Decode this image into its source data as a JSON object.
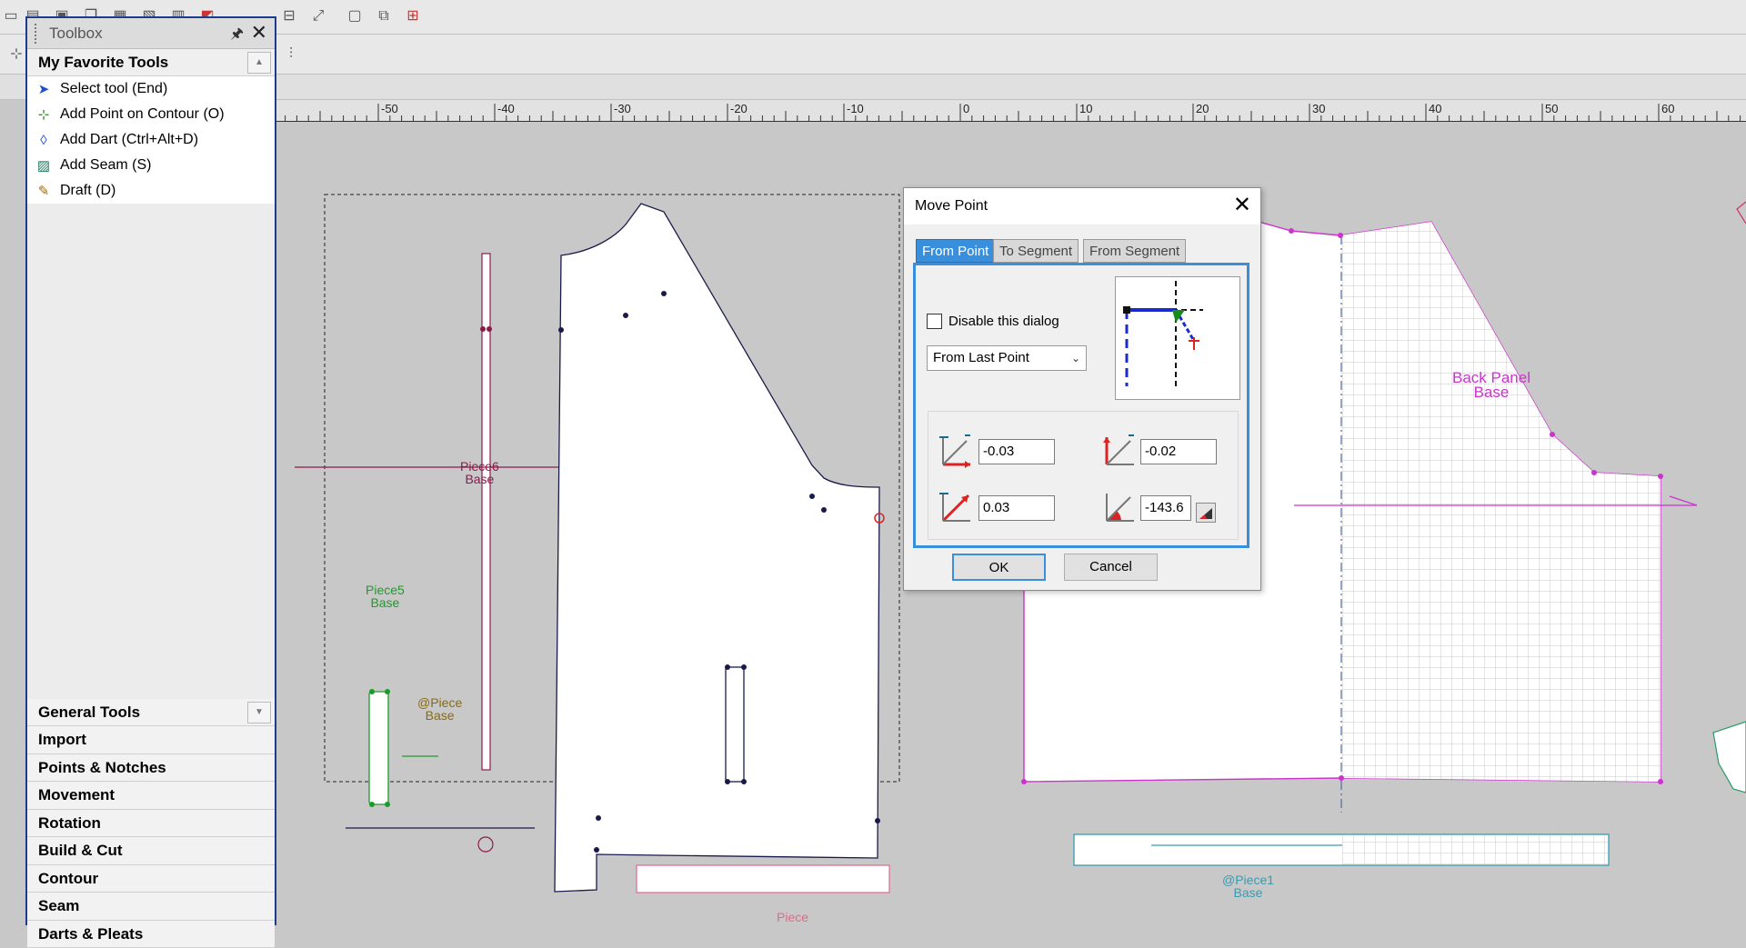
{
  "toolbox": {
    "title": "Toolbox",
    "favorites_header": "My Favorite Tools",
    "tools": [
      {
        "label": "Select tool (End)",
        "icon": "cursor-arrow-icon"
      },
      {
        "label": "Add Point on Contour (O)",
        "icon": "add-point-icon"
      },
      {
        "label": "Add Dart (Ctrl+Alt+D)",
        "icon": "dart-icon"
      },
      {
        "label": "Add Seam (S)",
        "icon": "seam-icon"
      },
      {
        "label": "Draft (D)",
        "icon": "draft-pen-icon"
      }
    ],
    "categories": [
      "General Tools",
      "Import",
      "Points & Notches",
      "Movement",
      "Rotation",
      "Build & Cut",
      "Contour",
      "Seam",
      "Darts & Pleats"
    ]
  },
  "ruler": {
    "labels": [
      "-50",
      "-40",
      "-30",
      "-20",
      "-10",
      "0",
      "10",
      "20",
      "30",
      "40",
      "50",
      "60"
    ]
  },
  "dialog": {
    "title": "Move Point",
    "tabs": [
      "From Point",
      "To Segment",
      "From Segment"
    ],
    "active_tab": "From Point",
    "disable_label": "Disable this dialog",
    "disable_checked": false,
    "mode_value": "From Last Point",
    "dx": "-0.03",
    "dy": "-0.02",
    "length": "0.03",
    "angle": "-143.6",
    "ok_label": "OK",
    "cancel_label": "Cancel"
  },
  "pieces": {
    "piece6": {
      "name": "Piece6",
      "layer": "Base"
    },
    "piece5": {
      "name": "Piece5",
      "layer": "Base"
    },
    "piece_at": {
      "name": "@Piece",
      "layer": "Base"
    },
    "back_panel": {
      "name": "Back Panel",
      "layer": "Base"
    },
    "piece1": {
      "name": "@Piece1",
      "layer": "Base"
    },
    "piece_bottom": {
      "name": "Piece"
    }
  },
  "colors": {
    "accent": "#3a8fdc",
    "toolbox_border": "#1e3c8c",
    "back_panel": "#cc33cc",
    "piece6": "#8b1a4a",
    "piece5": "#1e9a2a",
    "piece_at": "#8a6a10",
    "piece1": "#3a9ab0",
    "outline": "#1a1a4a"
  }
}
